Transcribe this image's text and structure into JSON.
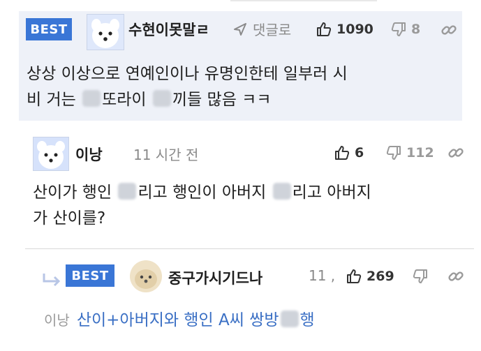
{
  "comments": [
    {
      "badge": "BEST",
      "username": "수현이못말ㄹ",
      "reply_label": "댓글로",
      "likes": "1090",
      "dislikes": "8",
      "lines": [
        "상상 이상으로 연예인이나 유명인한테 일부러 시",
        "비 거는 ",
        "또라이 ",
        "끼들 많음 ㅋㅋ"
      ]
    },
    {
      "username": "이낭",
      "time": "11 시간 전",
      "likes": "6",
      "dislikes": "112",
      "line1_a": "산이가 행인 ",
      "line1_b": "리고 행인이 아버지 ",
      "line1_c": "리고 아버지",
      "line2": "가 산이를?"
    },
    {
      "badge": "BEST",
      "username": "중구가시기드나",
      "time": "11 ,",
      "likes": "269",
      "mention": "이낭",
      "text_a": "산이+아버지와 행인 A씨 쌍방",
      "text_b": "행"
    }
  ],
  "icons": [
    "thumbs-up-icon",
    "thumbs-down-icon",
    "link-icon",
    "send-icon",
    "reply-arrow-icon"
  ],
  "colors": {
    "best_badge": "#3a76d6",
    "best_bg": "#eef1f8",
    "reply_text": "#3a6fc4",
    "meta_gray": "#8a8a8a"
  }
}
